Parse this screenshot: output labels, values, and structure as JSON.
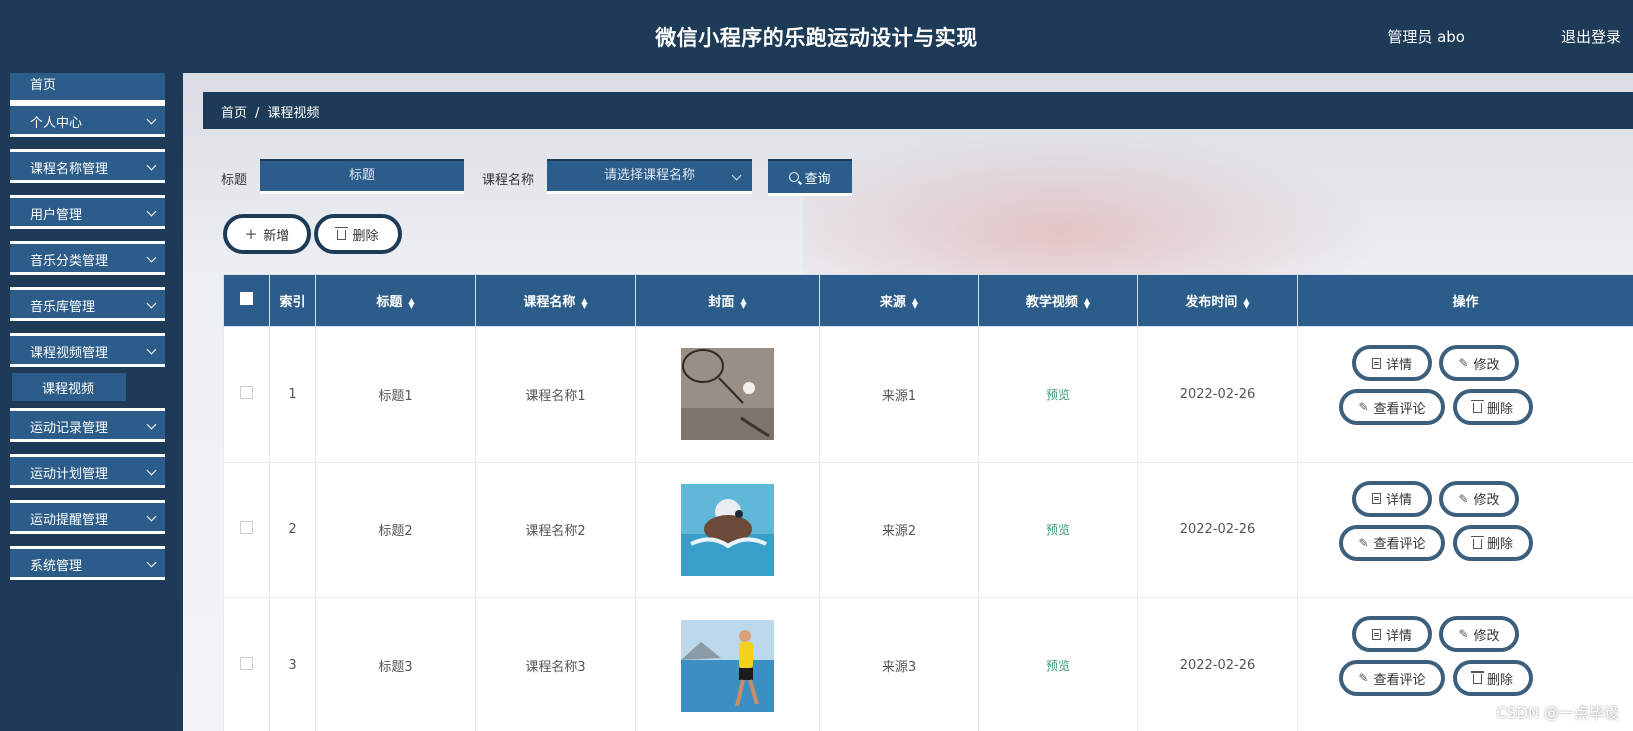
{
  "header": {
    "title": "微信小程序的乐跑运动设计与实现",
    "user": "管理员 abo",
    "logout": "退出登录"
  },
  "sidebar": {
    "items": [
      {
        "label": "首页"
      },
      {
        "label": "个人中心"
      },
      {
        "label": "课程名称管理"
      },
      {
        "label": "用户管理"
      },
      {
        "label": "音乐分类管理"
      },
      {
        "label": "音乐库管理"
      },
      {
        "label": "课程视频管理"
      },
      {
        "label": "运动记录管理"
      },
      {
        "label": "运动计划管理"
      },
      {
        "label": "运动提醒管理"
      },
      {
        "label": "系统管理"
      }
    ],
    "active_sub": "课程视频"
  },
  "breadcrumb": {
    "home": "首页",
    "sep": "/",
    "current": "课程视频"
  },
  "search": {
    "title_label": "标题",
    "title_placeholder": "标题",
    "course_label": "课程名称",
    "course_placeholder": "请选择课程名称",
    "query_label": "查询"
  },
  "actions": {
    "add": "新增",
    "delete": "删除"
  },
  "table": {
    "columns": [
      "索引",
      "标题",
      "课程名称",
      "封面",
      "来源",
      "教学视频",
      "发布时间",
      "操作"
    ],
    "rows": [
      {
        "index": "1",
        "title": "标题1",
        "course": "课程名称1",
        "cover": "badminton",
        "source": "来源1",
        "video": "预览",
        "date": "2022-02-26"
      },
      {
        "index": "2",
        "title": "标题2",
        "course": "课程名称2",
        "cover": "swimming",
        "source": "来源2",
        "video": "预览",
        "date": "2022-02-26"
      },
      {
        "index": "3",
        "title": "标题3",
        "course": "课程名称3",
        "cover": "running",
        "source": "来源3",
        "video": "预览",
        "date": "2022-02-26"
      }
    ],
    "row_ops": {
      "detail": "详情",
      "edit": "修改",
      "comments": "查看评论",
      "delete": "删除"
    }
  },
  "colors": {
    "dark": "#1d3a56",
    "accent": "#2c5d8a",
    "link": "#3a9b7a"
  },
  "watermark": "CSDN @一点毕设"
}
